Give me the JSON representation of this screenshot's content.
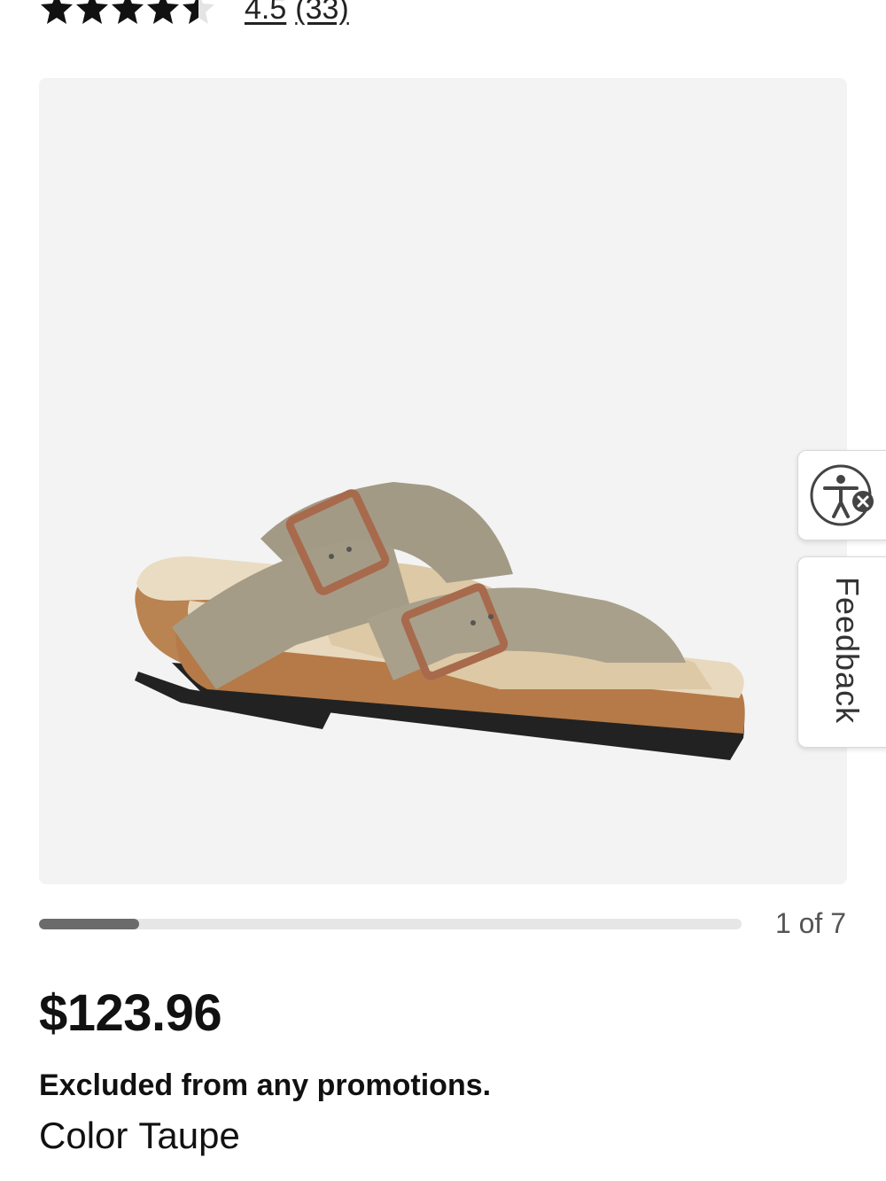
{
  "rating": {
    "value": "4.5",
    "count": "(33)",
    "stars_filled": 4.5,
    "stars_total": 5
  },
  "gallery": {
    "image": "sandal-product-photo",
    "counter": "1 of 7",
    "progress_fraction": 0.143,
    "background": "#f3f3f3"
  },
  "product": {
    "price": "$123.96",
    "promo_note": "Excluded from any promotions.",
    "color_label": "Color",
    "color_value": "Taupe"
  },
  "side_tabs": {
    "accessibility_icon": "accessibility-icon",
    "feedback_label": "Feedback"
  },
  "colors": {
    "text": "#111111",
    "progress_fill": "#6b6b6b",
    "progress_track": "#e6e6e6"
  }
}
